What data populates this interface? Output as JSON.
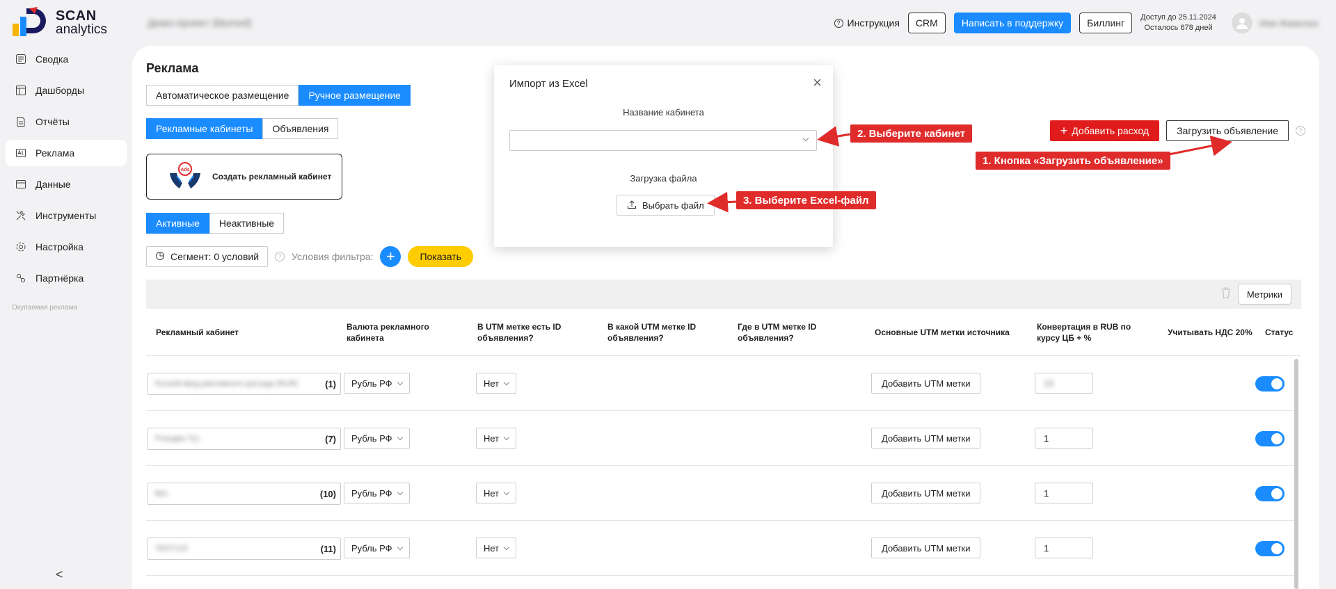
{
  "topbar": {
    "logo_line1": "SCAN",
    "logo_line2": "analytics",
    "project_name": "Демо-проект (blurred)",
    "help_label": "Инструкция",
    "crm_label": "CRM",
    "support_label": "Написать в поддержку",
    "billing_label": "Биллинг",
    "access_line1": "Доступ до 25.11.2024",
    "access_line2": "Осталось 678 дней",
    "user_name": "Имя Фамилия"
  },
  "sidebar": {
    "items": [
      {
        "label": "Сводка",
        "icon": "summary-icon"
      },
      {
        "label": "Дашборды",
        "icon": "dashboard-icon"
      },
      {
        "label": "Отчёты",
        "icon": "reports-icon"
      },
      {
        "label": "Реклама",
        "icon": "ads-icon",
        "active": true
      },
      {
        "label": "Данные",
        "icon": "data-icon"
      },
      {
        "label": "Инструменты",
        "icon": "tools-icon"
      },
      {
        "label": "Настройка",
        "icon": "settings-icon"
      },
      {
        "label": "Партнёрка",
        "icon": "partner-icon"
      }
    ],
    "note": "Окупаемая реклама",
    "collapse": "<"
  },
  "main": {
    "title": "Реклама",
    "placement_tabs": [
      "Автоматическое размещение",
      "Ручное размещение"
    ],
    "sub_tabs": [
      "Рекламные кабинеты",
      "Объявления"
    ],
    "create_card_label": "Создать рекламный кабинет",
    "status_tabs": [
      "Активные",
      "Неактивные"
    ],
    "segment_label": "Сегмент: 0 условий",
    "filter_label": "Условия фильтра:",
    "show_label": "Показать",
    "add_expense_label": "Добавить расход",
    "upload_ad_label": "Загрузить объявление",
    "metrics_label": "Метрики"
  },
  "table": {
    "headers": [
      "Рекламный кабинет",
      "Валюта рекламного кабинета",
      "В UTM метке есть ID объявления?",
      "В какой UTM метке ID объявления?",
      "Где в UTM метке ID объявления?",
      "Основные UTM метки источника",
      "Конвертация в RUB по курсу ЦБ + %",
      "Учитывать НДС 20%",
      "Статус"
    ],
    "rows": [
      {
        "cabinet": "Ручной ввод рекламного расхода (RUR)",
        "count": "(1)",
        "currency": "Рубль РФ",
        "has_id": "Нет",
        "utm_btn": "Добавить UTM метки",
        "conversion": "15"
      },
      {
        "cabinet": "Posoдka 7(r)",
        "count": "(7)",
        "currency": "Рубль РФ",
        "has_id": "Нет",
        "utm_btn": "Добавить UTM метки",
        "conversion": "1"
      },
      {
        "cabinet": "Вк1",
        "count": "(10)",
        "currency": "Рубль РФ",
        "has_id": "Нет",
        "utm_btn": "Добавить UTM метки",
        "conversion": "1"
      },
      {
        "cabinet": "TEST123",
        "count": "(11)",
        "currency": "Рубль РФ",
        "has_id": "Нет",
        "utm_btn": "Добавить UTM метки",
        "conversion": "1"
      }
    ]
  },
  "modal": {
    "title": "Импорт из Excel",
    "cabinet_label": "Название кабинета",
    "file_label": "Загрузка файла",
    "file_button": "Выбрать файл"
  },
  "annotations": {
    "step1": "1. Кнопка «Загрузить объявление»",
    "step2": "2. Выберите кабинет",
    "step3": "3. Выберите Excel-файл",
    "color": "#e02b2b"
  }
}
